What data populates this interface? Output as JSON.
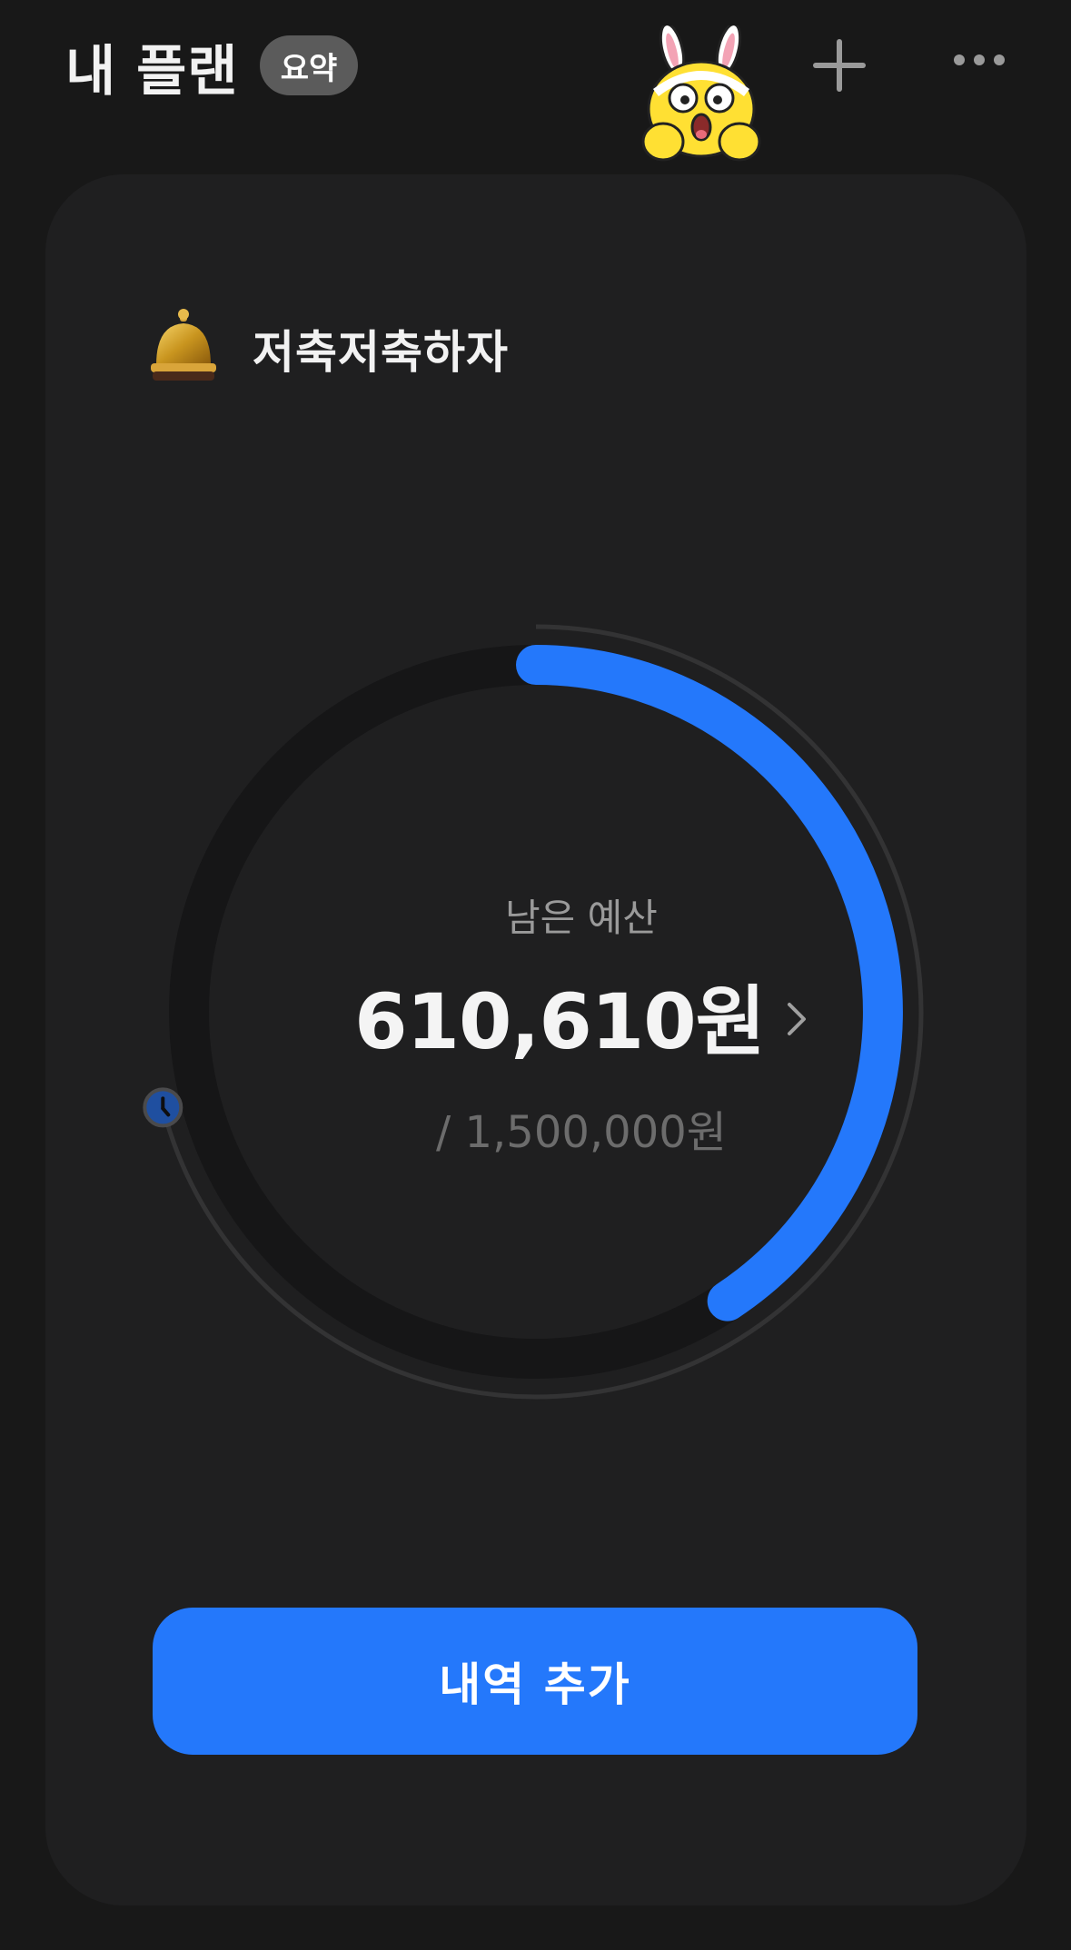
{
  "header": {
    "title": "내 플랜",
    "summary_badge": "요약",
    "sticker_icon": "rabbit-character-icon",
    "add_icon": "plus-icon",
    "more_icon": "more-dots-icon"
  },
  "plan": {
    "name": "저축저축하자",
    "icon": "bell-icon"
  },
  "budget": {
    "remaining_label": "남은 예산",
    "remaining_amount": "610,610원",
    "total_amount": "/ 1,500,000원",
    "remaining_fraction": 0.407,
    "period_elapsed_fraction": 0.71,
    "arc_color": "#2478fb"
  },
  "actions": {
    "add_entry_label": "내역 추가"
  },
  "colors": {
    "background": "#181818",
    "card": "#1f1f20",
    "accent": "#2478fb"
  }
}
